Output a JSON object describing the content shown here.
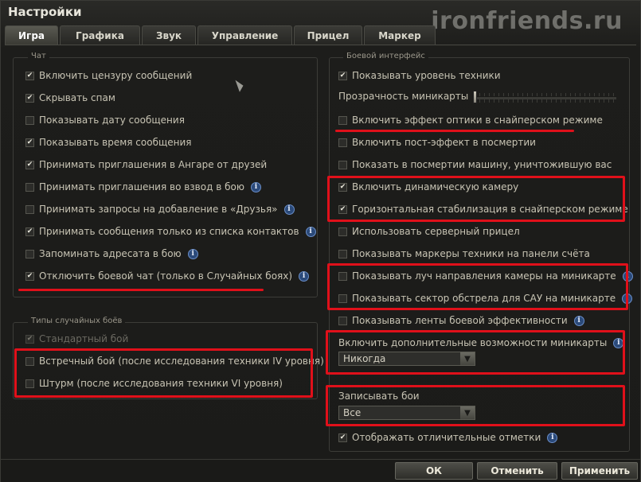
{
  "window": {
    "title": "Настройки",
    "watermark": "ironfriends.ru"
  },
  "tabs": [
    "Игра",
    "Графика",
    "Звук",
    "Управление",
    "Прицел",
    "Маркер"
  ],
  "chat": {
    "title": "Чат",
    "items": [
      {
        "label": "Включить цензуру сообщений",
        "checked": true
      },
      {
        "label": "Скрывать спам",
        "checked": true
      },
      {
        "label": "Показывать дату сообщения",
        "checked": false
      },
      {
        "label": "Показывать время сообщения",
        "checked": true
      },
      {
        "label": "Принимать приглашения в Ангаре от друзей",
        "checked": true
      },
      {
        "label": "Принимать приглашения во взвод в бою",
        "checked": false,
        "info": true
      },
      {
        "label": "Принимать запросы на добавление в «Друзья»",
        "checked": false,
        "info": true
      },
      {
        "label": "Принимать сообщения только из списка контактов",
        "checked": true,
        "info": true
      },
      {
        "label": "Запоминать адресата в бою",
        "checked": false,
        "info": true
      },
      {
        "label": "Отключить боевой чат (только в Случайных боях)",
        "checked": true,
        "info": true
      }
    ]
  },
  "battle_types": {
    "title": "Типы случайных боёв",
    "items": [
      {
        "label": "Стандартный бой",
        "checked": true,
        "disabled": true
      },
      {
        "label": "Встречный бой (после исследования техники IV уровня)",
        "checked": false
      },
      {
        "label": "Штурм (после исследования техники VI уровня)",
        "checked": false
      }
    ]
  },
  "battle_ui": {
    "title": "Боевой интерфейс",
    "show_tier": "Показывать уровень техники",
    "minimap_transparency": "Прозрачность миникарты",
    "items": [
      {
        "label": "Включить эффект оптики в снайперском режиме",
        "checked": false
      },
      {
        "label": "Включить пост-эффект в посмертии",
        "checked": false
      },
      {
        "label": "Показать в посмертии машину, уничтожившую вас",
        "checked": false
      },
      {
        "label": "Включить динамическую камеру",
        "checked": true
      },
      {
        "label": "Горизонтальная стабилизация в снайперском режиме",
        "checked": true
      },
      {
        "label": "Использовать серверный прицел",
        "checked": false
      },
      {
        "label": "Показывать маркеры техники на панели счёта",
        "checked": false
      },
      {
        "label": "Показывать луч направления камеры на миникарте",
        "checked": false,
        "info": true
      },
      {
        "label": "Показывать сектор обстрела для САУ на миникарте",
        "checked": false,
        "info": true
      },
      {
        "label": "Показывать ленты боевой эффективности",
        "checked": false,
        "info": true
      }
    ],
    "minimap_extra": {
      "label": "Включить дополнительные возможности миникарты",
      "value": "Никогда"
    },
    "record_battles": {
      "label": "Записывать бои",
      "value": "Все"
    },
    "show_marks": {
      "label": "Отображать отличительные отметки",
      "checked": true
    }
  },
  "footer": {
    "ok": "ОК",
    "cancel": "Отменить",
    "apply": "Применить"
  },
  "colors": {
    "highlight": "#e0101a",
    "info_icon": "#2b4a7a"
  }
}
